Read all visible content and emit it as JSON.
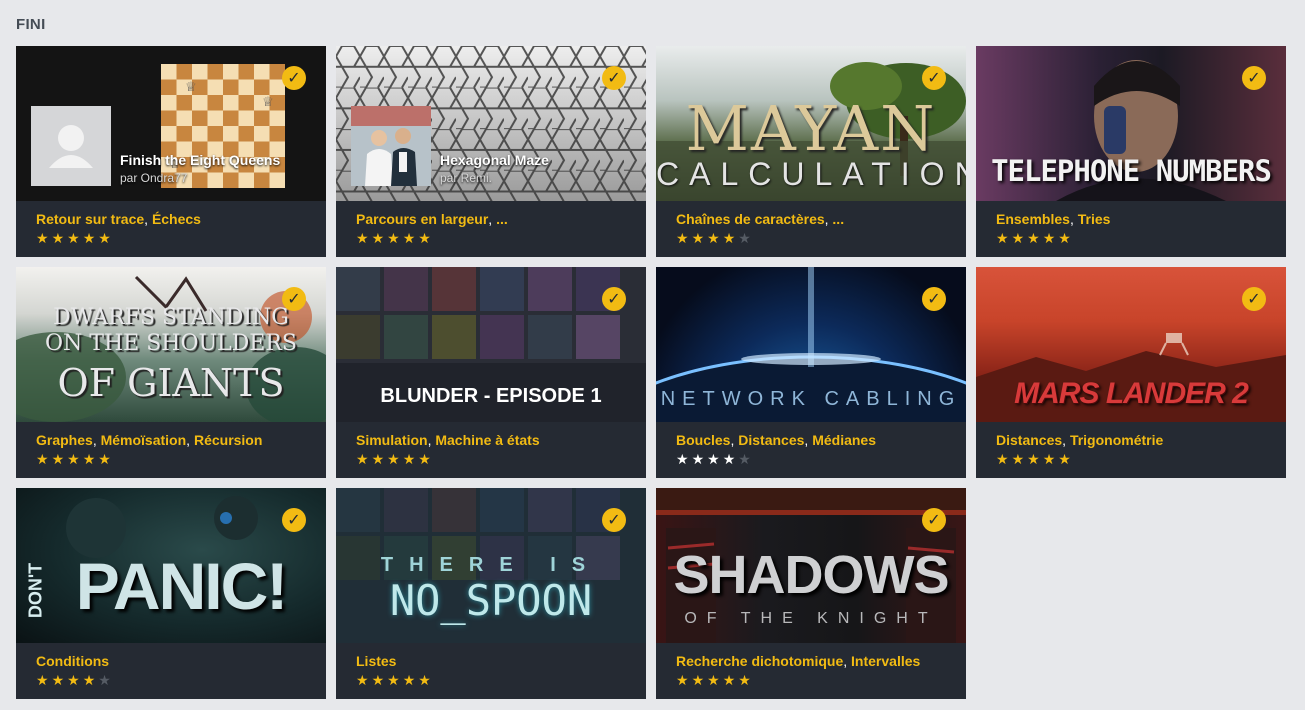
{
  "section": {
    "title": "FINI"
  },
  "colors": {
    "accent": "#f2bb13",
    "card_bg": "#252a33",
    "page_bg": "#e7e8eb"
  },
  "cards": [
    {
      "kind": "community",
      "cover_title": "Finish the Eight Queens",
      "author": "par Ondra77",
      "icon": "chessboard",
      "tags": [
        "Retour sur trace",
        "Échecs"
      ],
      "stars": 5,
      "star_style": "gold",
      "completed": true
    },
    {
      "kind": "community",
      "cover_title": "Hexagonal Maze",
      "author": "par Remi.",
      "icon": "hexagon-pattern",
      "tags": [
        "Parcours en largeur",
        "..."
      ],
      "stars": 5,
      "star_style": "gold",
      "completed": true
    },
    {
      "kind": "game",
      "cover_title": "MAYAN",
      "cover_subtitle": "CALCULATION",
      "tags": [
        "Chaînes de caractères",
        "..."
      ],
      "stars": 4,
      "star_style": "gold",
      "completed": true
    },
    {
      "kind": "game",
      "cover_title": "TELEPHONE NUMBERS",
      "tags": [
        "Ensembles",
        "Tries"
      ],
      "stars": 5,
      "star_style": "gold",
      "completed": true
    },
    {
      "kind": "game",
      "cover_title": "DWARFS STANDING",
      "cover_subtitle": "ON THE SHOULDERS",
      "cover_extra": "OF GIANTS",
      "tags": [
        "Graphes",
        "Mémoïsation",
        "Récursion"
      ],
      "stars": 5,
      "star_style": "gold",
      "completed": true
    },
    {
      "kind": "game",
      "cover_title": "BLUNDER - EPISODE 1",
      "tags": [
        "Simulation",
        "Machine à états"
      ],
      "stars": 5,
      "star_style": "gold",
      "completed": true
    },
    {
      "kind": "game",
      "cover_title": "NETWORK  CABLING",
      "tags": [
        "Boucles",
        "Distances",
        "Médianes"
      ],
      "stars": 4,
      "star_style": "white",
      "completed": true
    },
    {
      "kind": "game",
      "cover_title": "MARS LANDER 2",
      "tags": [
        "Distances",
        "Trigonométrie"
      ],
      "stars": 5,
      "star_style": "gold",
      "completed": true
    },
    {
      "kind": "game",
      "cover_title": "PANIC!",
      "cover_subtitle": "DON'T",
      "tags": [
        "Conditions"
      ],
      "stars": 4,
      "star_style": "gold",
      "completed": true
    },
    {
      "kind": "game",
      "cover_title": "THERE IS",
      "cover_subtitle": "NO_SPOON",
      "tags": [
        "Listes"
      ],
      "stars": 5,
      "star_style": "gold",
      "completed": true
    },
    {
      "kind": "game",
      "cover_title": "SHADOWS",
      "cover_subtitle": "OF THE KNIGHT",
      "tags": [
        "Recherche dichotomique",
        "Intervalles"
      ],
      "stars": 5,
      "star_style": "gold",
      "completed": true
    }
  ]
}
